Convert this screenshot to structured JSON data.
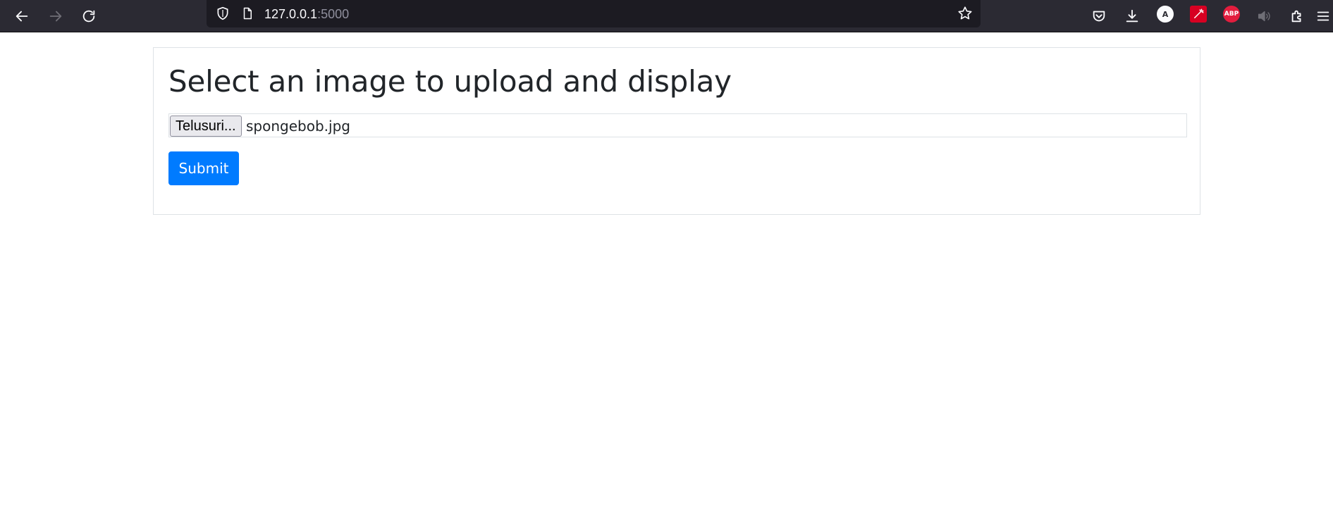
{
  "browser": {
    "url_host": "127.0.0.1",
    "url_port": ":5000",
    "icons": {
      "back": "back-arrow-icon",
      "forward": "forward-arrow-icon",
      "reload": "reload-icon",
      "shield": "tracking-protection-shield-icon",
      "page": "page-info-icon",
      "bookmark": "bookmark-star-icon",
      "pocket": "pocket-icon",
      "downloads": "downloads-icon",
      "account": "account-icon",
      "ext_red": "extension-icon",
      "abp": "adblock-plus-icon",
      "audio": "audio-icon",
      "extensions": "extensions-puzzle-icon",
      "menu": "hamburger-menu-icon"
    },
    "account_letter": "A",
    "abp_label": "ABP"
  },
  "page": {
    "title": "Select an image to upload and display",
    "file_button_label": "Telusuri...",
    "file_name": "spongebob.jpg",
    "submit_label": "Submit"
  },
  "colors": {
    "primary": "#007bff",
    "toolbar_bg": "#2b2a33",
    "urlbar_bg": "#1c1b22",
    "text": "#212529"
  }
}
